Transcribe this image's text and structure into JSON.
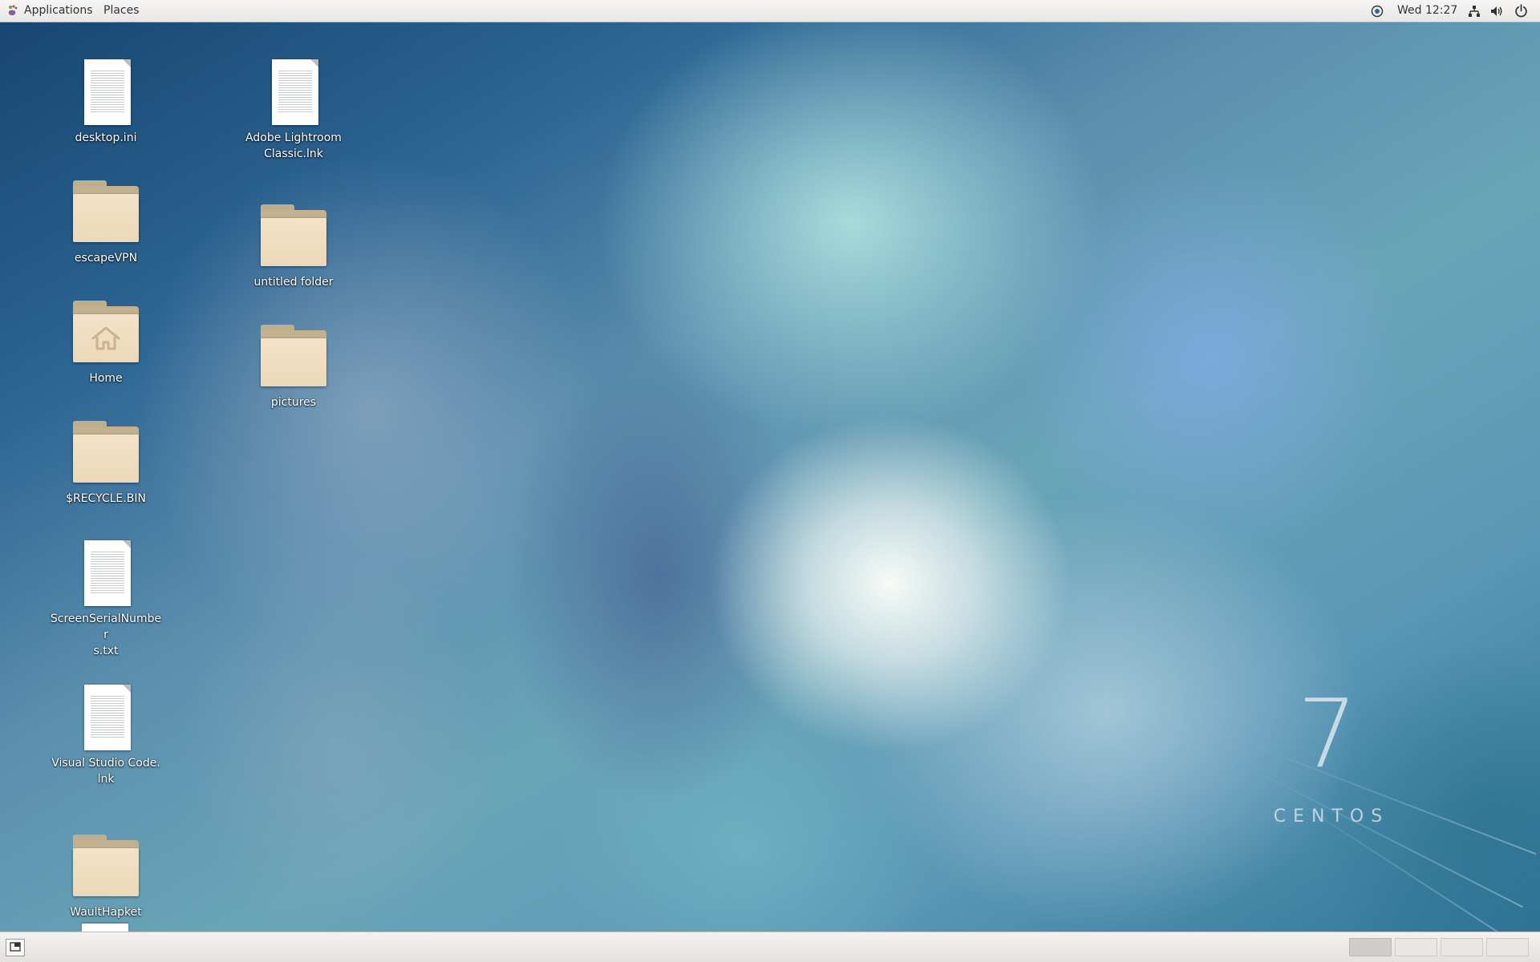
{
  "top_panel": {
    "applications_label": "Applications",
    "places_label": "Places",
    "clock": "Wed 12:27"
  },
  "desktop": {
    "icons": [
      {
        "label": "desktop.ini",
        "type": "document"
      },
      {
        "label": "escapeVPN",
        "type": "folder"
      },
      {
        "label": "Home",
        "type": "home-folder"
      },
      {
        "label": "$RECYCLE.BIN",
        "type": "folder"
      },
      {
        "label": "ScreenSerialNumber\ns.txt",
        "type": "document"
      },
      {
        "label": "Visual Studio Code.\nlnk",
        "type": "document"
      },
      {
        "label": "WaultHapket",
        "type": "folder"
      },
      {
        "label": "Adobe Lightroom\nClassic.lnk",
        "type": "document"
      },
      {
        "label": "untitled folder",
        "type": "folder"
      },
      {
        "label": "pictures",
        "type": "folder"
      }
    ]
  },
  "branding": {
    "version": "7",
    "name": "CENTOS"
  },
  "bottom_panel": {
    "workspaces": [
      {
        "active": true
      },
      {
        "active": false
      },
      {
        "active": false
      },
      {
        "active": false
      }
    ]
  },
  "colors": {
    "panel_bg": "#ecebe9",
    "folder_front": "#f0ddc0",
    "folder_back": "#c2b190",
    "label_text": "#ffffff"
  }
}
